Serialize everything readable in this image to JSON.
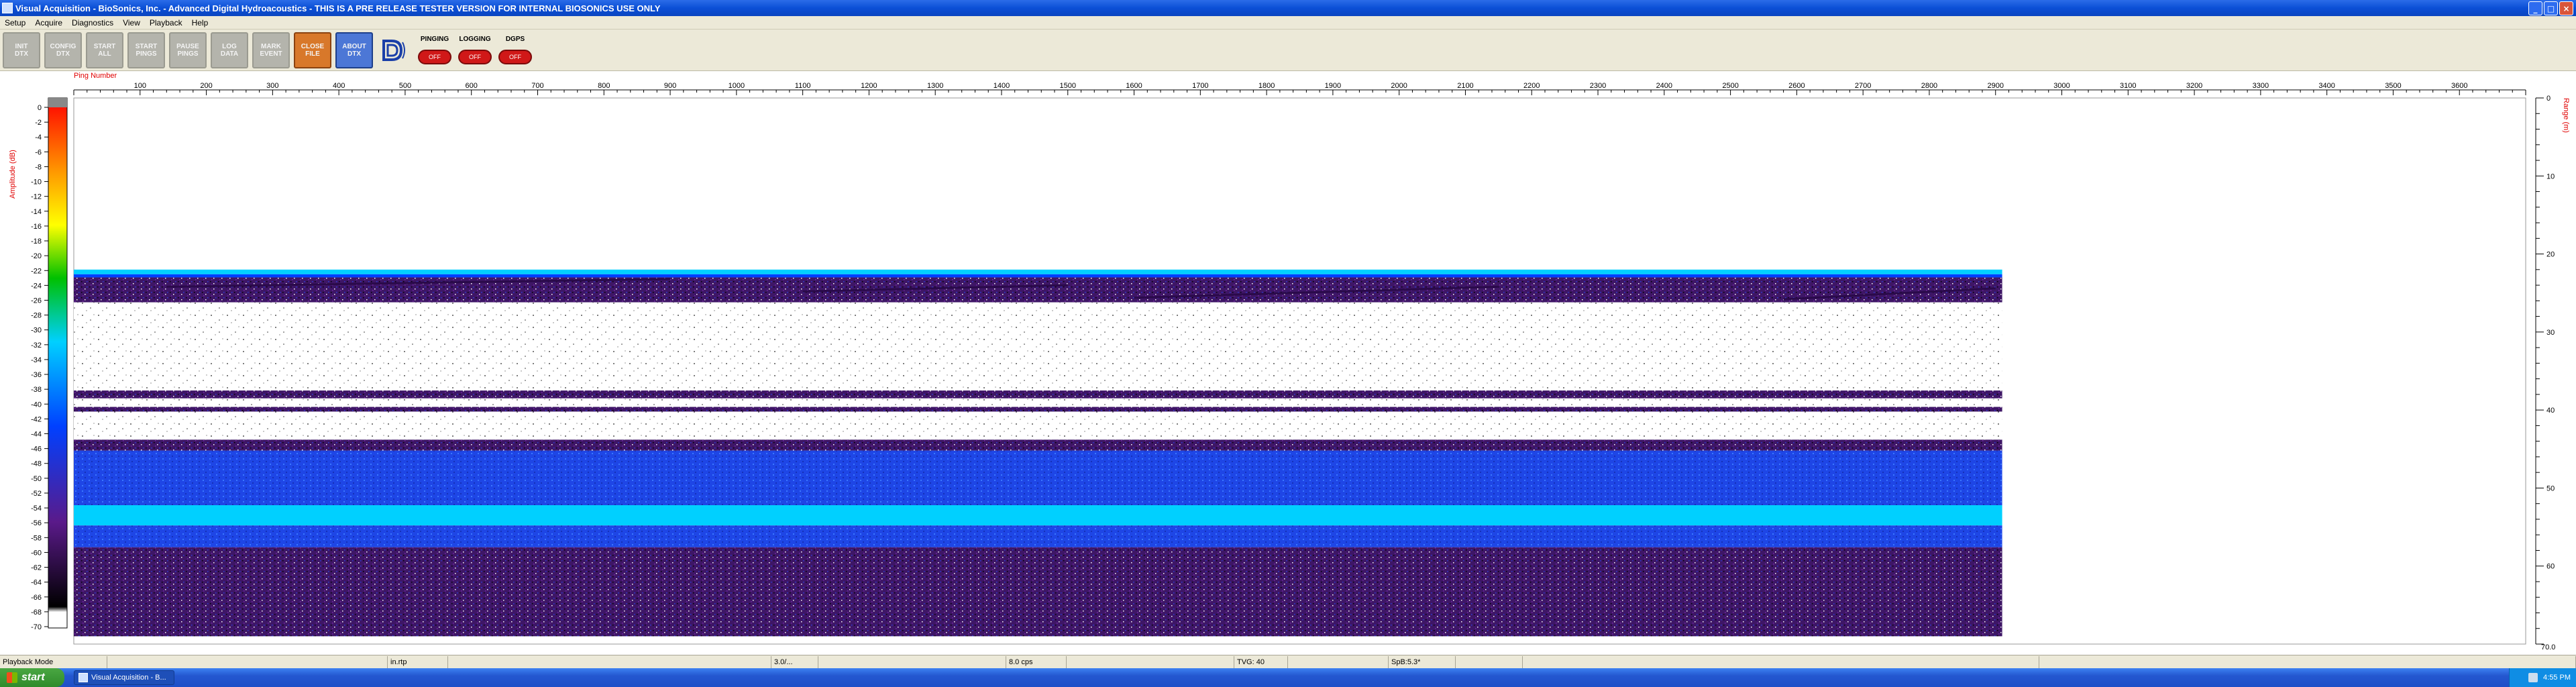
{
  "window": {
    "title": "Visual Acquisition  -  BioSonics, Inc.  -  Advanced Digital Hydroacoustics  -  THIS IS A PRE RELEASE TESTER VERSION FOR INTERNAL BIOSONICS USE ONLY",
    "minimize": "_",
    "maximize": "□",
    "close": "×"
  },
  "menu": [
    "Setup",
    "Acquire",
    "Diagnostics",
    "View",
    "Playback",
    "Help"
  ],
  "toolbar": {
    "buttons": [
      {
        "l1": "INIT",
        "l2": "DTX",
        "style": "gray"
      },
      {
        "l1": "CONFIG",
        "l2": "DTX",
        "style": "gray"
      },
      {
        "l1": "START",
        "l2": "ALL",
        "style": "gray"
      },
      {
        "l1": "START",
        "l2": "PINGS",
        "style": "gray"
      },
      {
        "l1": "PAUSE",
        "l2": "PINGS",
        "style": "gray"
      },
      {
        "l1": "LOG",
        "l2": "DATA",
        "style": "gray"
      },
      {
        "l1": "MARK",
        "l2": "EVENT",
        "style": "gray"
      },
      {
        "l1": "CLOSE",
        "l2": "FILE",
        "style": "orange"
      },
      {
        "l1": "ABOUT",
        "l2": "DTX",
        "style": "blue"
      }
    ],
    "status": [
      {
        "label": "PINGING",
        "value": "OFF"
      },
      {
        "label": "LOGGING",
        "value": "OFF"
      },
      {
        "label": "DGPS",
        "value": "OFF"
      }
    ]
  },
  "plot": {
    "x_axis_title": "Ping Number",
    "x_ticks": [
      100,
      200,
      300,
      400,
      500,
      600,
      700,
      800,
      900,
      1000,
      1100,
      1200,
      1300,
      1400,
      1500,
      1600,
      1700,
      1800,
      1900,
      2000,
      2100,
      2200,
      2300,
      2400,
      2500,
      2600,
      2700,
      2800,
      2900,
      3000,
      3100,
      3200,
      3300,
      3400,
      3500,
      3600
    ],
    "x_range": [
      0,
      3700
    ],
    "data_end_ping": 2910,
    "colorbar_title": "Amplitude (dB)",
    "colorbar_ticks": [
      0,
      -2,
      -4,
      -6,
      -8,
      -10,
      -12,
      -14,
      -16,
      -18,
      -20,
      -22,
      -24,
      -26,
      -28,
      -30,
      -32,
      -34,
      -36,
      -38,
      -40,
      -42,
      -44,
      -46,
      -48,
      -50,
      -52,
      -54,
      -56,
      -58,
      -60,
      -62,
      -64,
      -66,
      -68,
      -70
    ],
    "range_title": "Range (m)",
    "range_ticks": [
      0,
      10,
      20,
      30,
      40,
      50,
      60
    ],
    "range_max_label": "70.0",
    "range_max": 70,
    "bottom_depth_m": 22,
    "colors": {
      "red": "#ff0000",
      "orange": "#ff9900",
      "yellow": "#ffff00",
      "green": "#00c000",
      "cyan": "#00d0ff",
      "blue": "#0040ff",
      "purple": "#5a1a8a",
      "black": "#000000",
      "white": "#ffffff"
    }
  },
  "statusbar": [
    "Playback Mode",
    "",
    "in.rtp",
    "",
    "3.0/...",
    "",
    "8.0 cps",
    "",
    "TVG: 40",
    "",
    "SpB:5.3*",
    "",
    "",
    ""
  ],
  "taskbar": {
    "start": "start",
    "task": "Visual Acquisition - B...",
    "clock": "4:55 PM"
  }
}
